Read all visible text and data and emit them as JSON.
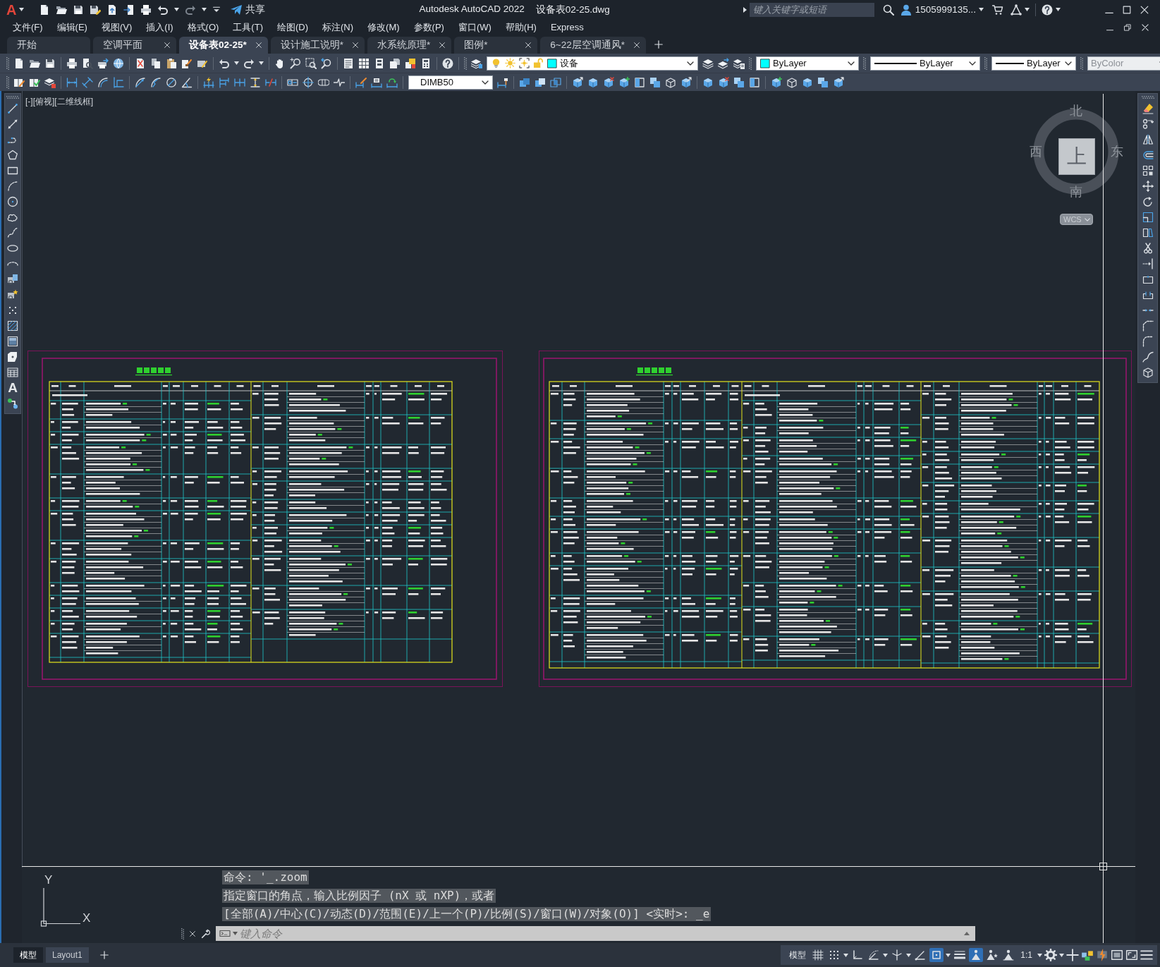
{
  "title_bar": {
    "logo": "A",
    "share": "共享",
    "app_title": "Autodesk AutoCAD 2022",
    "file_name": "设备表02-25.dwg",
    "search": {
      "placeholder": "键入关键字或短语"
    },
    "user": "1505999135..."
  },
  "menu_bar": {
    "items": [
      "文件(F)",
      "编辑(E)",
      "视图(V)",
      "插入(I)",
      "格式(O)",
      "工具(T)",
      "绘图(D)",
      "标注(N)",
      "修改(M)",
      "参数(P)",
      "窗口(W)",
      "帮助(H)",
      "Express"
    ]
  },
  "file_tabs": [
    {
      "label": "开始",
      "closable": false,
      "selected": false
    },
    {
      "label": "空调平面",
      "closable": true,
      "selected": false
    },
    {
      "label": "设备表02-25*",
      "closable": true,
      "selected": true
    },
    {
      "label": "设计施工说明*",
      "closable": true,
      "selected": false
    },
    {
      "label": "水系统原理*",
      "closable": true,
      "selected": false
    },
    {
      "label": "图例*",
      "closable": true,
      "selected": false
    },
    {
      "label": "6~22层空调通风*",
      "closable": true,
      "selected": false
    }
  ],
  "layer_toolbar": {
    "layer": "设备",
    "color_control": "ByLayer",
    "linetype": "ByLayer",
    "lineweight": "ByLayer",
    "plot_style": {
      "value": "ByColor",
      "disabled": true
    }
  },
  "dimension_toolbar": {
    "dim_style": "DIMB50"
  },
  "draw_toolbar": {
    "text_tool": "A"
  },
  "viewport": {
    "label": "[-][俯视][二维线框]",
    "view_cube": {
      "north": "北",
      "west": "西",
      "top": "上",
      "east": "东",
      "south": "南",
      "ucs": "WCS"
    }
  },
  "ucs_icon": {
    "y_label": "Y",
    "x_label": "X"
  },
  "command_window": {
    "history": [
      "命令: '_.zoom",
      "指定窗口的角点，输入比例因子 (nX 或 nXP)，或者",
      "[全部(A)/中心(C)/动态(D)/范围(E)/上一个(P)/比例(S)/窗口(W)/对象(O)] <实时>: _e"
    ],
    "input": {
      "placeholder": "键入命令"
    }
  },
  "layout_tabs": [
    {
      "label": "模型",
      "selected": true
    },
    {
      "label": "Layout1",
      "selected": false
    }
  ],
  "status_bar": {
    "space": "模型",
    "toggles": [
      {
        "kind": "grid",
        "on": false
      },
      {
        "kind": "snap",
        "on": false
      },
      {
        "kind": "ortho",
        "on": false
      },
      {
        "kind": "polar",
        "on": false
      },
      {
        "kind": "isodraft",
        "on": false
      },
      {
        "kind": "tracking",
        "on": false
      },
      {
        "kind": "osnap",
        "on": true
      },
      {
        "kind": "lineweight",
        "on": false
      },
      {
        "kind": "annotation-visibility",
        "on": true
      },
      {
        "kind": "autoscale",
        "on": false
      }
    ],
    "annotation_scale": "1:1"
  }
}
